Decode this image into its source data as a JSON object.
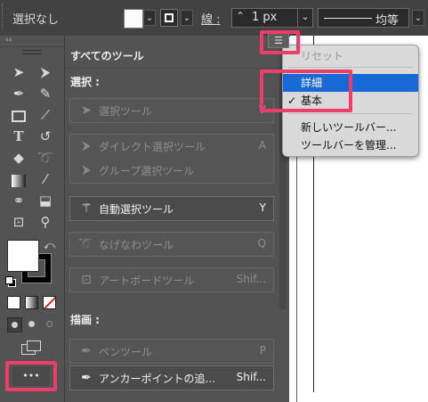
{
  "control_bar": {
    "selection_status": "選択なし",
    "stroke_label": "線 :",
    "stroke_weight": "1 px",
    "stroke_profile": "均等",
    "fill_color": "#ffffff",
    "stroke_color": "#000000"
  },
  "toolbar": {
    "collapse_glyph": "‹‹",
    "fill_color": "#ffffff",
    "stroke_color": "#000000",
    "more_tools_label": "•••"
  },
  "panel": {
    "title": "すべてのツール",
    "sections": [
      {
        "title": "選択 :",
        "tools": [
          {
            "label": "選択ツール",
            "shortcut": "V",
            "icon": "selection-arrow-icon",
            "available": false
          },
          {
            "label": "ダイレクト選択ツール",
            "shortcut": "A",
            "icon": "direct-selection-icon",
            "available": false
          },
          {
            "label": "グループ選択ツール",
            "shortcut": "",
            "icon": "group-selection-icon",
            "available": false
          },
          {
            "label": "自動選択ツール",
            "shortcut": "Y",
            "icon": "magic-wand-icon",
            "available": true
          },
          {
            "label": "なげなわツール",
            "shortcut": "Q",
            "icon": "lasso-icon",
            "available": false
          },
          {
            "label": "アートボードツール",
            "shortcut": "Shif...",
            "icon": "artboard-icon",
            "available": false
          }
        ]
      },
      {
        "title": "描画 :",
        "tools": [
          {
            "label": "ペンツール",
            "shortcut": "P",
            "icon": "pen-icon",
            "available": false
          },
          {
            "label": "アンカーポイントの追...",
            "shortcut": "Shif...",
            "icon": "add-anchor-point-icon",
            "available": true
          }
        ]
      }
    ]
  },
  "menu": {
    "items": [
      {
        "label": "リセット",
        "enabled": false,
        "selected": false,
        "checked": false
      },
      {
        "label": "詳細",
        "enabled": true,
        "selected": true,
        "checked": false
      },
      {
        "label": "基本",
        "enabled": true,
        "selected": false,
        "checked": true
      },
      {
        "label": "新しいツールバー...",
        "enabled": true,
        "selected": false,
        "checked": false
      },
      {
        "label": "ツールバーを管理...",
        "enabled": true,
        "selected": false,
        "checked": false
      }
    ],
    "check_glyph": "✓"
  },
  "accent": {
    "callout": "#ec3e6b",
    "menu_highlight": "#1868d8",
    "artboard_edge": "#e22424"
  }
}
